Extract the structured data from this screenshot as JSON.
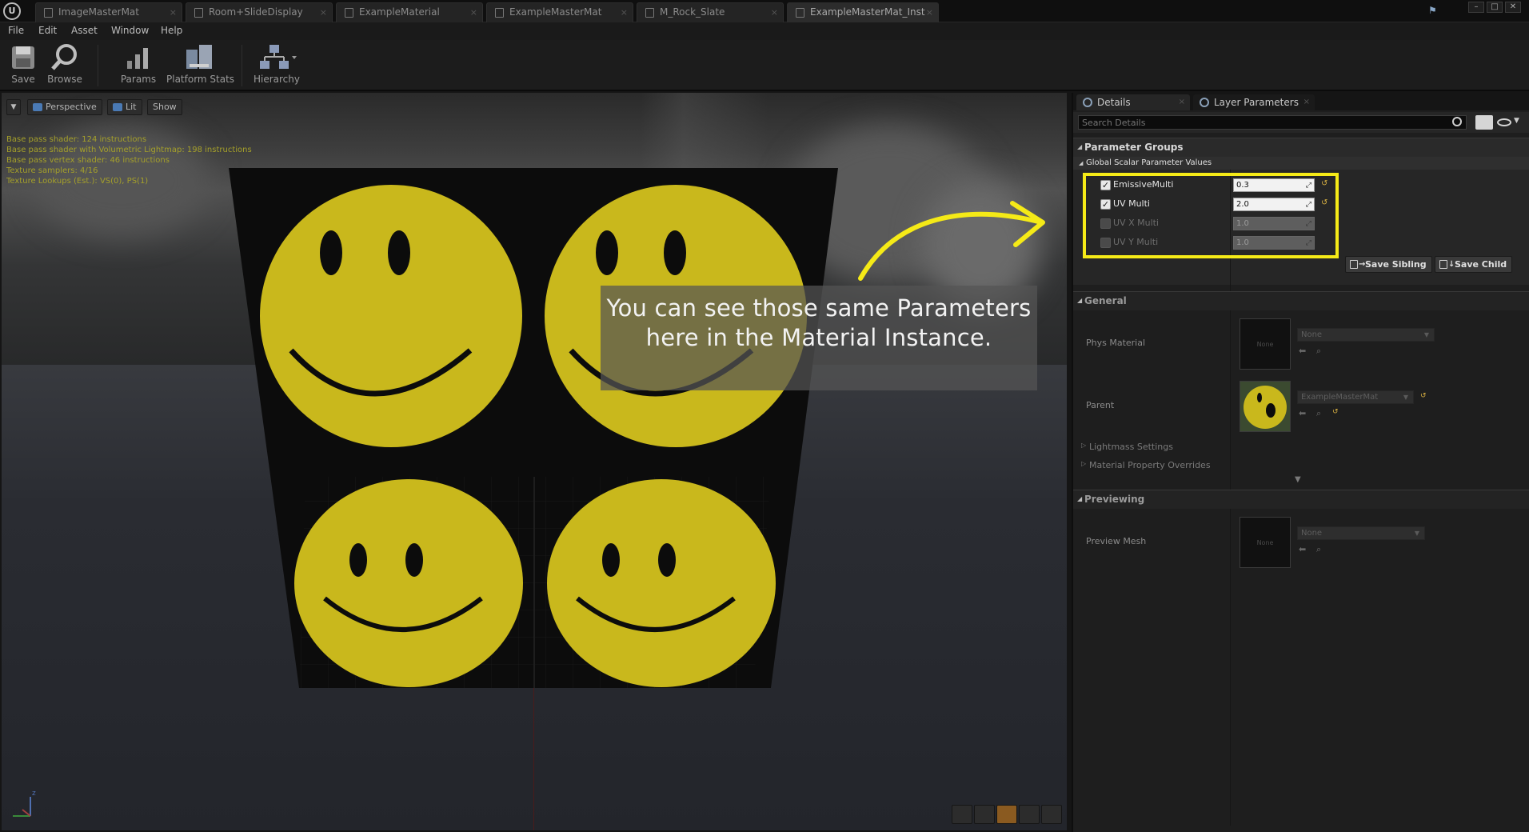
{
  "tabs": [
    {
      "label": "ImageMasterMat",
      "active": false
    },
    {
      "label": "Room+SlideDisplay",
      "active": false
    },
    {
      "label": "ExampleMaterial",
      "active": false
    },
    {
      "label": "ExampleMasterMat",
      "active": false
    },
    {
      "label": "M_Rock_Slate",
      "active": false
    },
    {
      "label": "ExampleMasterMat_Inst",
      "active": true
    }
  ],
  "menu": [
    "File",
    "Edit",
    "Asset",
    "Window",
    "Help"
  ],
  "toolbar": {
    "save": "Save",
    "browse": "Browse",
    "params": "Params",
    "platform_stats": "Platform Stats",
    "hierarchy": "Hierarchy"
  },
  "viewport": {
    "perspective": "Perspective",
    "lit": "Lit",
    "show": "Show",
    "stats": [
      "Base pass shader: 124 instructions",
      "Base pass shader with Volumetric Lightmap: 198 instructions",
      "Base pass vertex shader: 46 instructions",
      "Texture samplers: 4/16",
      "Texture Lookups (Est.): VS(0), PS(1)"
    ]
  },
  "caption": "You can see those same Parameters here in the Material Instance.",
  "details": {
    "tab_details": "Details",
    "tab_layer_parameters": "Layer Parameters",
    "search_placeholder": "Search Details",
    "parameter_groups": "Parameter Groups",
    "global_scalar": "Global Scalar Parameter Values",
    "params": [
      {
        "name": "EmissiveMulti",
        "value": "0.3",
        "enabled": true
      },
      {
        "name": "UV Multi",
        "value": "2.0",
        "enabled": true
      },
      {
        "name": "UV X Multi",
        "value": "1.0",
        "enabled": false
      },
      {
        "name": "UV Y Multi",
        "value": "1.0",
        "enabled": false
      }
    ],
    "save_sibling": "Save Sibling",
    "save_child": "Save Child",
    "general": "General",
    "phys_material_label": "Phys Material",
    "phys_material_value": "None",
    "phys_thumb": "None",
    "parent_label": "Parent",
    "parent_value": "ExampleMasterMat",
    "lightmass_settings": "Lightmass Settings",
    "material_property_overrides": "Material Property Overrides",
    "previewing": "Previewing",
    "preview_mesh_label": "Preview Mesh",
    "preview_mesh_value": "None",
    "preview_thumb": "None"
  },
  "colors": {
    "highlight": "#f5ea17",
    "smiley": "#c9b81c",
    "stats_text": "#a5a02a"
  },
  "icons": [
    "ue-logo-icon",
    "save-icon",
    "browse-icon",
    "params-icon",
    "platform-stats-icon",
    "hierarchy-icon",
    "search-icon",
    "grid-view-icon",
    "eye-icon"
  ]
}
